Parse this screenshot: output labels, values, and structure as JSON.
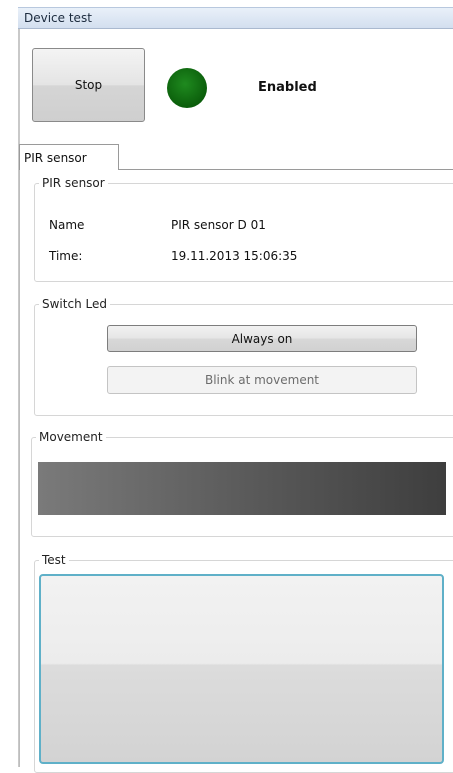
{
  "window": {
    "title": "Device test"
  },
  "toolbar": {
    "stop_label": "Stop",
    "status_text": "Enabled",
    "status_color": "#0b6b0b"
  },
  "tabs": [
    {
      "label": "PIR sensor",
      "active": true
    }
  ],
  "pir_group": {
    "legend": "PIR sensor",
    "rows": [
      {
        "label": "Name",
        "value": "PIR sensor D 01"
      },
      {
        "label": "Time:",
        "value": "19.11.2013 15:06:35"
      }
    ]
  },
  "switch_group": {
    "legend": "Switch Led",
    "always_on_label": "Always on",
    "blink_label": "Blink at movement"
  },
  "movement_group": {
    "legend": "Movement"
  },
  "test_group": {
    "legend": "Test"
  },
  "colors": {
    "accent_border": "#5fb0c8",
    "titlebar": "#dfe8f4"
  }
}
